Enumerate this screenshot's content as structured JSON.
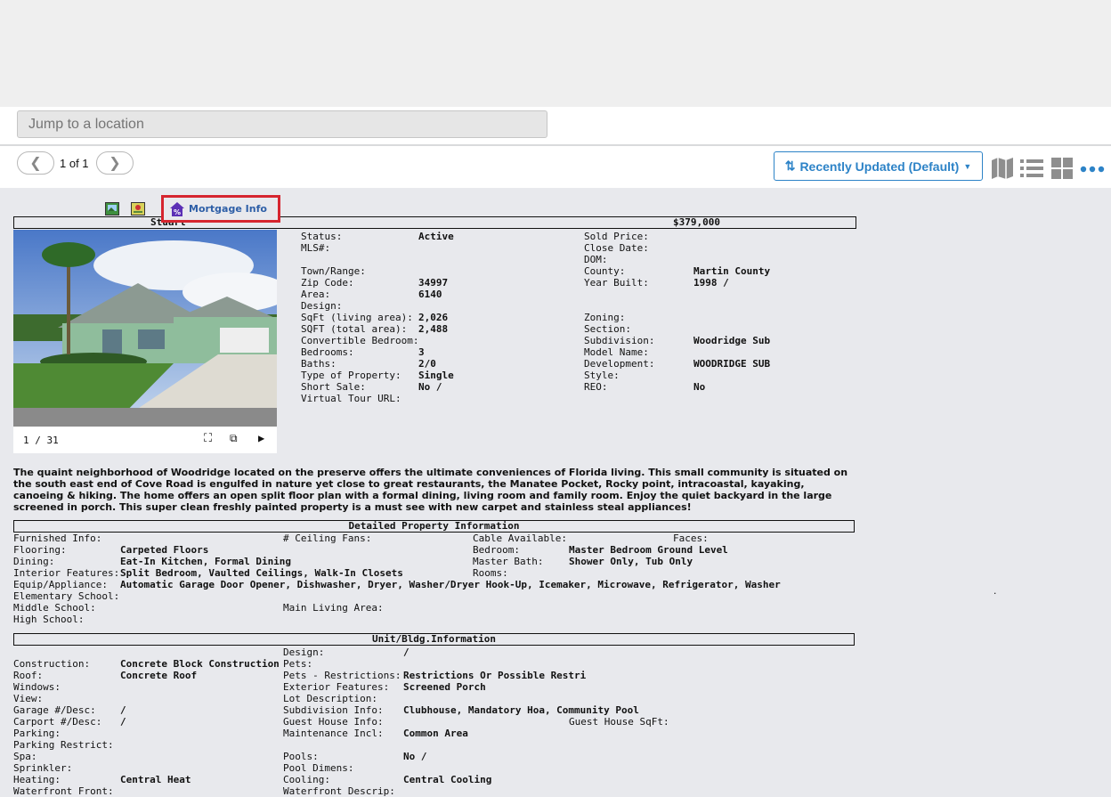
{
  "search": {
    "placeholder": "Jump to a location"
  },
  "pager": {
    "text": "1 of 1"
  },
  "sort": {
    "label": "Recently Updated (Default)"
  },
  "toolbar": {
    "mortgage_label": "Mortgage Info"
  },
  "listing": {
    "city": "Stuart",
    "price": "$379,000",
    "photo_counter": "1 / 31",
    "description": "The quaint neighborhood of Woodridge located on the preserve offers the ultimate conveniences of Florida living. This small community is situated on the south east end of Cove Road is engulfed in nature yet close to great restaurants, the Manatee Pocket, Rocky point, intracoastal, kayaking, canoeing & hiking. The home offers an open split floor plan with a formal dining, living room and family room. Enjoy the quiet backyard in the large screened in porch. This super clean freshly painted property is a must see with new carpet and stainless steal appliances!",
    "left_fields": [
      {
        "label": "Status:",
        "value": "Active"
      },
      {
        "label": "MLS#:",
        "value": ""
      },
      {
        "label": "",
        "value": ""
      },
      {
        "label": "Town/Range:",
        "value": ""
      },
      {
        "label": "Zip Code:",
        "value": "34997"
      },
      {
        "label": "Area:",
        "value": "6140"
      },
      {
        "label": "Design:",
        "value": ""
      },
      {
        "label": "SqFt (living area):",
        "value": "2,026"
      },
      {
        "label": "SQFT (total area):",
        "value": "2,488"
      },
      {
        "label": "Convertible Bedroom:",
        "value": ""
      },
      {
        "label": "Bedrooms:",
        "value": "3"
      },
      {
        "label": "Baths:",
        "value": "2/0"
      },
      {
        "label": "Type of Property:",
        "value": "Single"
      },
      {
        "label": "Short Sale:",
        "value": "No /"
      },
      {
        "label": "Virtual Tour URL:",
        "value": ""
      }
    ],
    "right_fields": [
      {
        "label": "Sold Price:",
        "value": ""
      },
      {
        "label": "Close Date:",
        "value": ""
      },
      {
        "label": "DOM:",
        "value": ""
      },
      {
        "label": "County:",
        "value": "Martin County"
      },
      {
        "label": "Year Built:",
        "value": "1998 /"
      },
      {
        "label": "",
        "value": ""
      },
      {
        "label": "",
        "value": ""
      },
      {
        "label": "Zoning:",
        "value": ""
      },
      {
        "label": "Section:",
        "value": ""
      },
      {
        "label": "Subdivision:",
        "value": "Woodridge Sub"
      },
      {
        "label": "Model Name:",
        "value": ""
      },
      {
        "label": "Development:",
        "value": "WOODRIDGE SUB"
      },
      {
        "label": "Style:",
        "value": ""
      },
      {
        "label": "REO:",
        "value": "No"
      }
    ]
  },
  "detailed": {
    "title": "Detailed Property Information",
    "rows": [
      {
        "label": "Furnished Info:",
        "value": ""
      },
      {
        "label": "Flooring:",
        "value": "Carpeted Floors"
      },
      {
        "label": "Dining:",
        "value": "Eat-In Kitchen, Formal Dining"
      },
      {
        "label": "Interior Features:",
        "value": "Split Bedroom, Vaulted Ceilings, Walk-In Closets"
      },
      {
        "label": "Equip/Appliance:",
        "value": "Automatic Garage Door Opener, Dishwasher, Dryer, Washer/Dryer Hook-Up, Icemaker, Microwave, Refrigerator, Washer"
      },
      {
        "label": "Elementary School:",
        "value": ""
      },
      {
        "label": "Middle School:",
        "value": ""
      },
      {
        "label": "High School:",
        "value": ""
      }
    ],
    "mid": [
      {
        "label": "# Ceiling Fans:",
        "value": ""
      },
      {
        "label": "",
        "value": ""
      },
      {
        "label": "",
        "value": ""
      },
      {
        "label": "",
        "value": ""
      },
      {
        "label": "",
        "value": ""
      },
      {
        "label": "",
        "value": ""
      },
      {
        "label": "Main Living Area:",
        "value": ""
      }
    ],
    "right": [
      {
        "label": "Cable Available:",
        "value": ""
      },
      {
        "label": "Bedroom:",
        "value": "Master Bedroom Ground Level"
      },
      {
        "label": "Master Bath:",
        "value": "Shower Only, Tub Only"
      },
      {
        "label": "Rooms:",
        "value": ""
      }
    ],
    "faces_label": "Faces:"
  },
  "unit": {
    "title": "Unit/Bldg.Information",
    "left": [
      {
        "label": "",
        "value": ""
      },
      {
        "label": "Construction:",
        "value": "Concrete Block Construction"
      },
      {
        "label": "Roof:",
        "value": "Concrete Roof"
      },
      {
        "label": "Windows:",
        "value": ""
      },
      {
        "label": "View:",
        "value": ""
      },
      {
        "label": "Garage #/Desc:",
        "value": "/"
      },
      {
        "label": "Carport #/Desc:",
        "value": "/"
      },
      {
        "label": "Parking:",
        "value": ""
      },
      {
        "label": "Parking Restrict:",
        "value": ""
      },
      {
        "label": "Spa:",
        "value": ""
      },
      {
        "label": "Sprinkler:",
        "value": ""
      },
      {
        "label": "Heating:",
        "value": "Central Heat"
      },
      {
        "label": "Waterfront Front:",
        "value": ""
      }
    ],
    "right": [
      {
        "label": "Design:",
        "value": "/"
      },
      {
        "label": "Pets:",
        "value": ""
      },
      {
        "label": "Pets - Restrictions:",
        "value": "Restrictions Or Possible Restri"
      },
      {
        "label": "Exterior Features:",
        "value": "Screened Porch"
      },
      {
        "label": "Lot Description:",
        "value": ""
      },
      {
        "label": "Subdivision Info:",
        "value": "Clubhouse, Mandatory Hoa, Community Pool"
      },
      {
        "label": "Guest House Info:",
        "value": ""
      },
      {
        "label": "Maintenance Incl:",
        "value": "Common Area"
      },
      {
        "label": "",
        "value": ""
      },
      {
        "label": "Pools:",
        "value": "No /"
      },
      {
        "label": "Pool Dimens:",
        "value": ""
      },
      {
        "label": "Cooling:",
        "value": "Central Cooling"
      },
      {
        "label": "Waterfront Descrip:",
        "value": ""
      }
    ],
    "guest_sqft_label": "Guest House SqFt:"
  },
  "colors": {
    "accent": "#2d83c7",
    "highlight": "#d6252f",
    "link": "#2e5fa7"
  }
}
